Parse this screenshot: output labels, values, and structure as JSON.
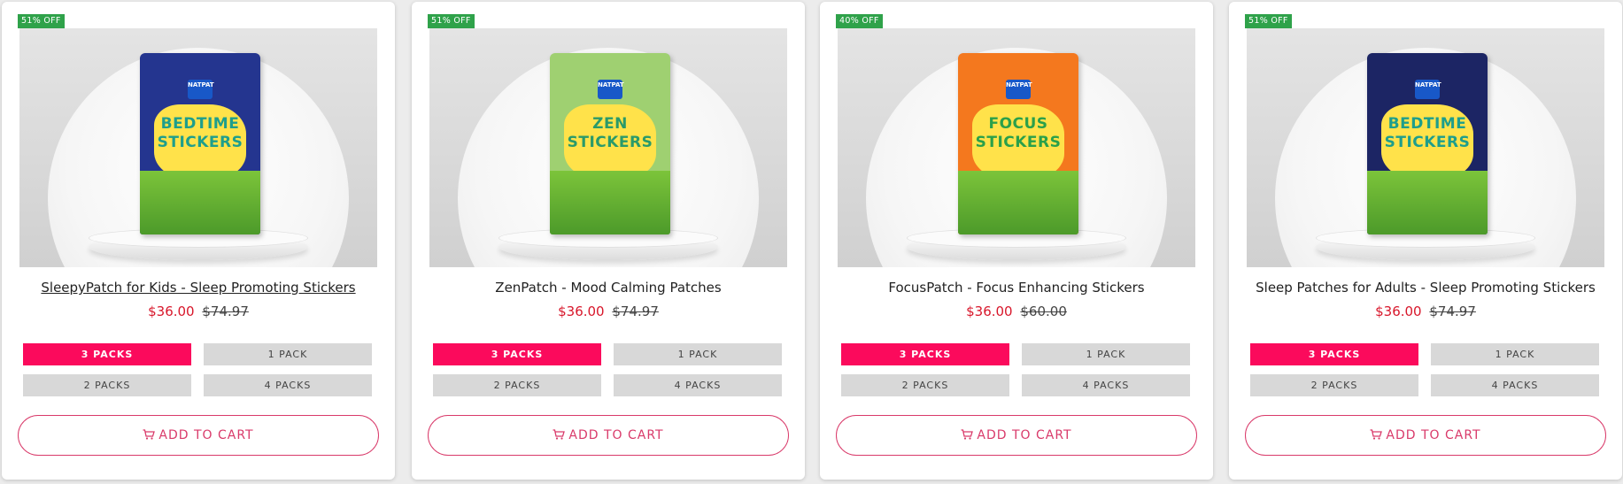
{
  "products": [
    {
      "discount_badge": "51% OFF",
      "title": "SleepyPatch for Kids - Sleep Promoting Stickers",
      "price": "$36.00",
      "compare_price": "$74.97",
      "options": [
        "3 PACKS",
        "1 PACK",
        "2 PACKS",
        "4 PACKS"
      ],
      "selected_option": "3 PACKS",
      "cart_label": "ADD TO CART",
      "package": {
        "name_line1": "BEDTIME",
        "name_line2": "STICKERS",
        "color": "#24358f",
        "title_color": "#1e9e8c"
      }
    },
    {
      "discount_badge": "51% OFF",
      "title": "ZenPatch - Mood Calming Patches",
      "price": "$36.00",
      "compare_price": "$74.97",
      "options": [
        "3 PACKS",
        "1 PACK",
        "2 PACKS",
        "4 PACKS"
      ],
      "selected_option": "3 PACKS",
      "cart_label": "ADD TO CART",
      "package": {
        "name_line1": "ZEN",
        "name_line2": "STICKERS",
        "color": "#9fd071",
        "title_color": "#2a9a6a"
      }
    },
    {
      "discount_badge": "40% OFF",
      "title": "FocusPatch - Focus Enhancing Stickers",
      "price": "$36.00",
      "compare_price": "$60.00",
      "options": [
        "3 PACKS",
        "1 PACK",
        "2 PACKS",
        "4 PACKS"
      ],
      "selected_option": "3 PACKS",
      "cart_label": "ADD TO CART",
      "package": {
        "name_line1": "FOCUS",
        "name_line2": "STICKERS",
        "color": "#f4781e",
        "title_color": "#2aa04a"
      }
    },
    {
      "discount_badge": "51% OFF",
      "title": "Sleep Patches for Adults - Sleep Promoting Stickers",
      "price": "$36.00",
      "compare_price": "$74.97",
      "options": [
        "3 PACKS",
        "1 PACK",
        "2 PACKS",
        "4 PACKS"
      ],
      "selected_option": "3 PACKS",
      "cart_label": "ADD TO CART",
      "package": {
        "name_line1": "BEDTIME",
        "name_line2": "STICKERS",
        "color": "#1c2564",
        "title_color": "#1e9e8c"
      }
    }
  ],
  "brand_mark": "NATPAT",
  "colors": {
    "badge": "#2fa24a",
    "sale_price": "#d8172b",
    "selected_option": "#fb0a5c",
    "cart_accent": "#d93a6a"
  },
  "icons": {
    "cart": "cart-icon"
  }
}
